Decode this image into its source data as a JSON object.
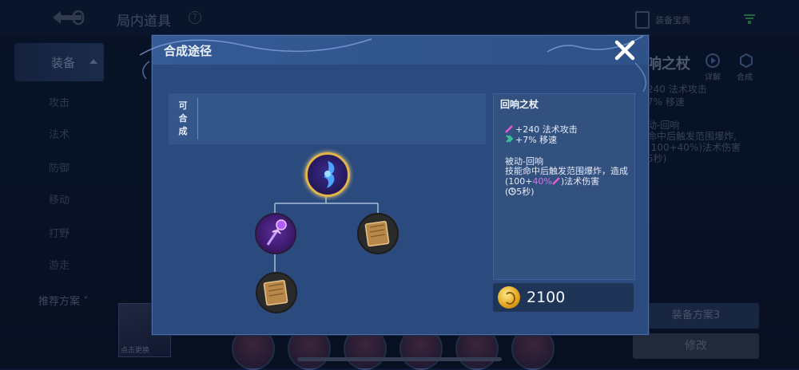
{
  "background": {
    "title": "局内道具",
    "help": "?",
    "manual_label": "装备宝典",
    "sidebar": {
      "active": "装备",
      "items": [
        "攻击",
        "法术",
        "防御",
        "移动",
        "打野",
        "游走"
      ],
      "recommend": "推荐方案"
    },
    "right": {
      "item_title_partial": "响之杖",
      "detail_label": "详解",
      "compose_label": "合成",
      "stat1": "240 法术攻击",
      "stat2": "7% 移速",
      "passive_title": "动-回响",
      "passive_line1": "命中后触发范围爆炸,",
      "passive_line2": "(100+40%",
      "passive_line3": ")法术伤害",
      "passive_line4": "5秒)"
    },
    "hero_label": "点击更换",
    "plan_button": "装备方案3",
    "edit_button": "修改"
  },
  "modal": {
    "title": "合成途径",
    "craftable_label": [
      "可",
      "合",
      "成"
    ],
    "item": {
      "name": "回响之杖",
      "stats": [
        "+240 法术攻击",
        "+7% 移速"
      ],
      "passive_title": "被动-回响",
      "passive_desc_pre": "技能命中后触发范围爆炸，造成(100+",
      "passive_desc_hl": "40%",
      "passive_desc_post": ")法术伤害",
      "cooldown": "(",
      "cooldown_value": "5秒)",
      "price": "2100"
    },
    "tree_icons": {
      "root": "echo-staff-icon",
      "left": "arcane-staff-icon",
      "right": "spellbook-icon",
      "leaf": "spellbook-icon"
    }
  },
  "colors": {
    "highlight": "#d972e6",
    "gold": "#e2b54a",
    "modal_bg": "#2b4a7d"
  }
}
